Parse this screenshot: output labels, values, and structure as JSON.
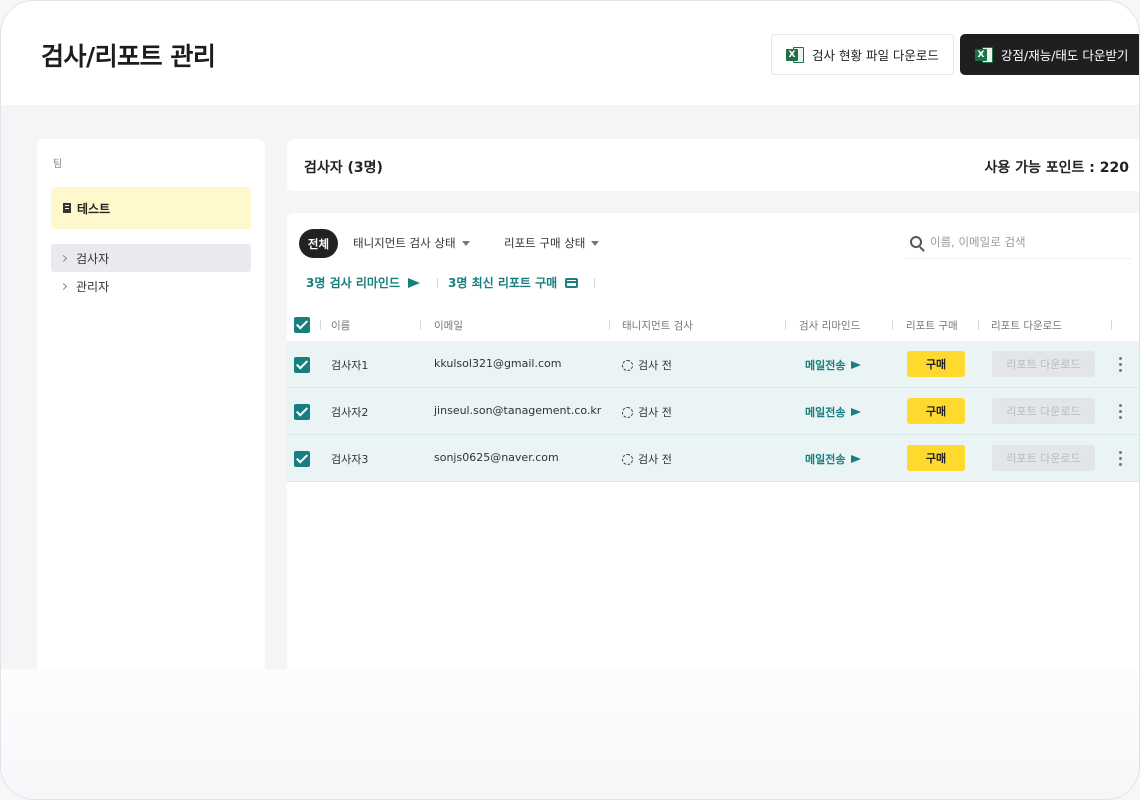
{
  "header": {
    "title": "검사/리포트 관리",
    "btn_status_file": "검사 현황 파일 다운로드",
    "btn_strength": "강점/재능/태도 다운받기",
    "excel_glyph": "X"
  },
  "sidebar": {
    "label": "팀",
    "team": "테스트",
    "items": [
      {
        "label": "검사자"
      },
      {
        "label": "관리자"
      }
    ]
  },
  "summary": {
    "title": "검사자 (3명)",
    "points": "사용 가능 포인트 : 220"
  },
  "filters": {
    "all": "전체",
    "test_status": "태니지먼트 검사 상태",
    "report_status": "리포트 구매 상태",
    "search_placeholder": "이름, 이메일로 검색"
  },
  "actions": {
    "remind": "3명 검사 리마인드",
    "purchase": "3명 최신 리포트 구매"
  },
  "table": {
    "columns": [
      "이름",
      "이메일",
      "태니지먼트 검사",
      "검사 리마인드",
      "리포트 구매",
      "리포트 다운로드"
    ],
    "rows": [
      {
        "name": "검사자1",
        "email": "kkulsol321@gmail.com",
        "status": "검사 전",
        "remind": "메일전송",
        "buy": "구매",
        "download": "리포트 다운로드"
      },
      {
        "name": "검사자2",
        "email": "jinseul.son@tanagement.co.kr",
        "status": "검사 전",
        "remind": "메일전송",
        "buy": "구매",
        "download": "리포트 다운로드"
      },
      {
        "name": "검사자3",
        "email": "sonjs0625@naver.com",
        "status": "검사 전",
        "remind": "메일전송",
        "buy": "구매",
        "download": "리포트 다운로드"
      }
    ]
  },
  "colors": {
    "accent_teal": "#17807f",
    "buy_yellow": "#ffd92e",
    "team_highlight": "#fff8cc",
    "row_selected": "#eaf4f5"
  }
}
